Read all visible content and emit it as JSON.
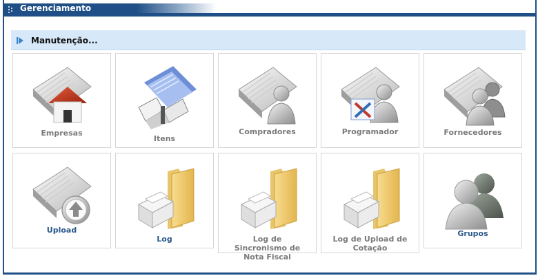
{
  "window": {
    "title": "Gerenciamento"
  },
  "section": {
    "title": "Manutenção..."
  },
  "tiles": [
    {
      "label": "Empresas",
      "icon": "empresas-icon"
    },
    {
      "label": "Itens",
      "icon": "itens-icon"
    },
    {
      "label": "Compradores",
      "icon": "compradores-icon"
    },
    {
      "label": "Programador",
      "icon": "programador-icon"
    },
    {
      "label": "Fornecedores",
      "icon": "fornecedores-icon"
    },
    {
      "label": "Upload",
      "icon": "upload-icon"
    },
    {
      "label": "Log",
      "icon": "log-folder-icon"
    },
    {
      "label": "Log de Sincronismo de Nota Fiscal",
      "icon": "log-sync-folder-icon"
    },
    {
      "label": "Log de Upload de Cotação",
      "icon": "log-upload-folder-icon"
    },
    {
      "label": "Grupos",
      "icon": "grupos-icon"
    }
  ],
  "colors": {
    "header": "#1f4f86",
    "section_bg": "#d7e8f9",
    "label_grey": "#7a7a7a",
    "label_blue": "#2b5a8c"
  }
}
